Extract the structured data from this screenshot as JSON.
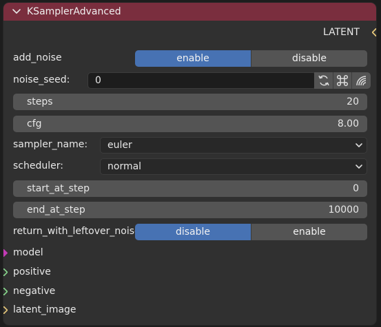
{
  "node": {
    "title": "KSamplerAdvanced",
    "output": {
      "label": "LATENT"
    },
    "add_noise": {
      "label": "add_noise",
      "options": [
        "enable",
        "disable"
      ],
      "selected": "enable"
    },
    "noise_seed": {
      "label": "noise_seed:",
      "value": "0"
    },
    "steps": {
      "label": "steps",
      "value": "20"
    },
    "cfg": {
      "label": "cfg",
      "value": "8.00"
    },
    "sampler_name": {
      "label": "sampler_name:",
      "value": "euler"
    },
    "scheduler": {
      "label": "scheduler:",
      "value": "normal"
    },
    "start_at_step": {
      "label": "start_at_step",
      "value": "0"
    },
    "end_at_step": {
      "label": "end_at_step",
      "value": "10000"
    },
    "return_with_leftover_noise": {
      "label": "return_with_leftover_noise",
      "options": [
        "disable",
        "enable"
      ],
      "selected": "disable"
    },
    "inputs": [
      "model",
      "positive",
      "negative",
      "latent_image"
    ]
  },
  "colors": {
    "header": "#7a2e3e",
    "accent": "#4772b3",
    "socket_latent": "#e6c77a",
    "socket_model": "#c23bb5",
    "socket_conditioning": "#86d68b"
  },
  "icons": [
    "collapse-chevron-icon",
    "refresh-icon",
    "random-dice-icon",
    "signal-icon",
    "dropdown-chevron-icon"
  ]
}
